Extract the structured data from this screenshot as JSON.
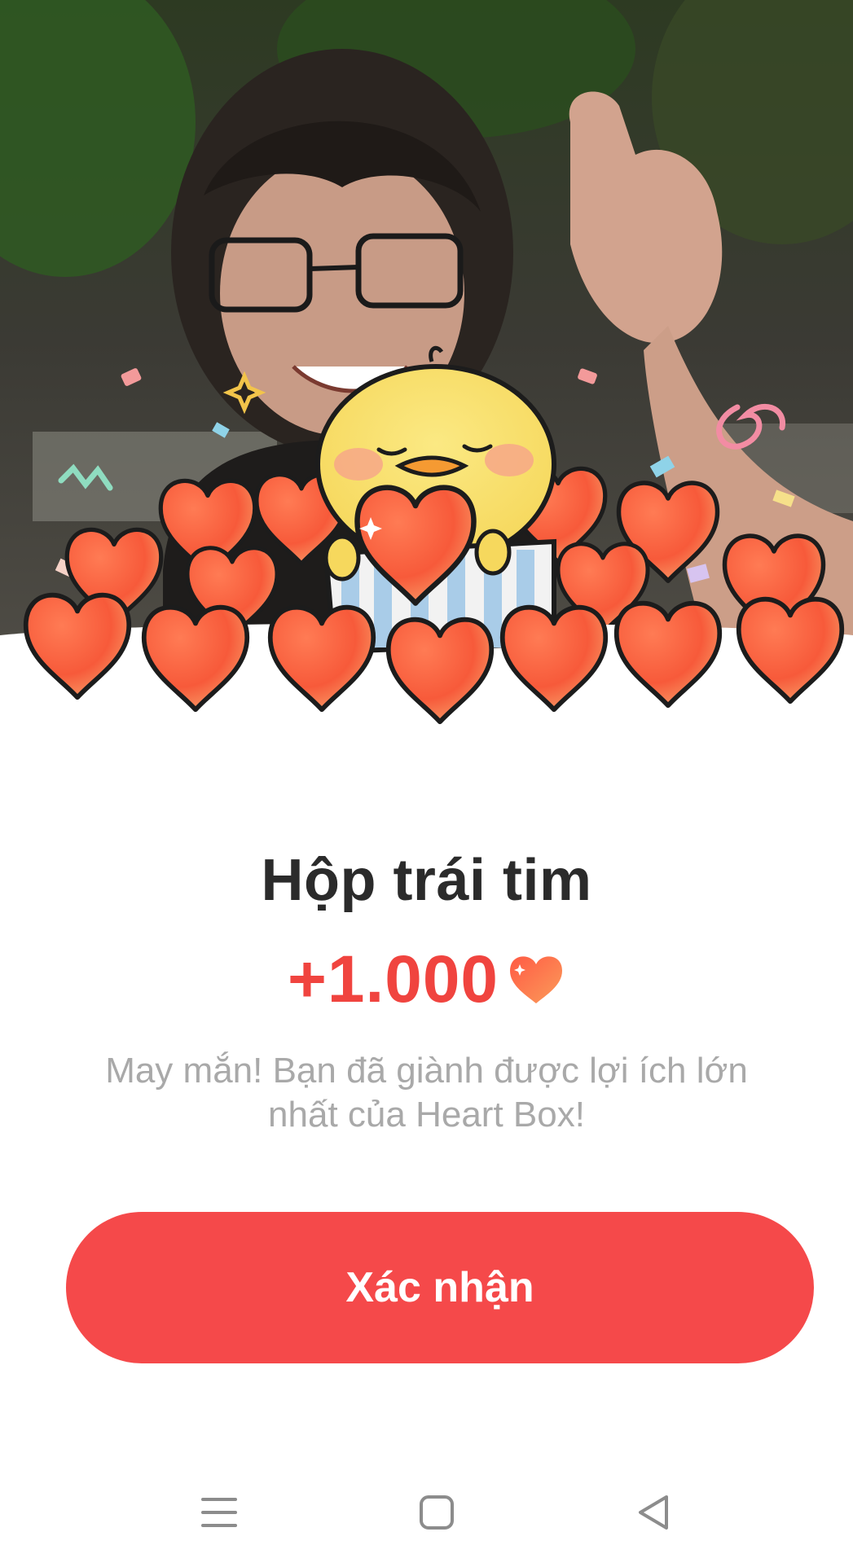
{
  "dialog": {
    "title": "Hộp trái tim",
    "reward_amount": "+1.000",
    "description": "May mắn! Bạn đã giành được lợi ích lớn nhất của Heart Box!",
    "confirm_label": "Xác nhận"
  },
  "icons": {
    "reward": "heart-icon",
    "nav_menu": "menu-icon",
    "nav_home": "home-square-icon",
    "nav_back": "back-triangle-icon"
  },
  "colors": {
    "accent": "#f5494a",
    "amount_text": "#f0443f",
    "title_text": "#2b2b2b",
    "desc_text": "#a9a9a9"
  }
}
